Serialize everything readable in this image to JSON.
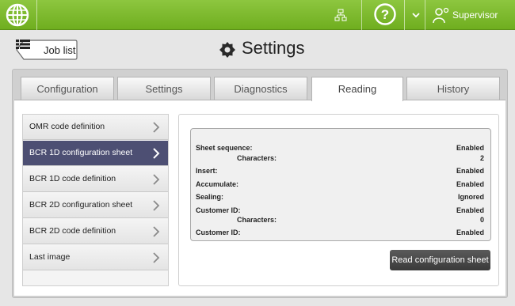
{
  "topbar": {
    "role": "Supervisor",
    "accent": "#8dc63f",
    "icons": [
      "globe-icon",
      "network-icon",
      "help-icon",
      "dropdown-icon",
      "user-icon"
    ]
  },
  "header": {
    "back_label": "Job list",
    "title": "Settings"
  },
  "tabs": [
    {
      "label": "Configuration"
    },
    {
      "label": "Settings"
    },
    {
      "label": "Diagnostics"
    },
    {
      "label": "Reading",
      "active": true
    },
    {
      "label": "History"
    }
  ],
  "menu": [
    {
      "label": "OMR code definition"
    },
    {
      "label": "BCR 1D configuration sheet",
      "selected": true
    },
    {
      "label": "BCR 1D code definition"
    },
    {
      "label": "BCR 2D configuration sheet"
    },
    {
      "label": "BCR 2D code definition"
    },
    {
      "label": "Last image"
    }
  ],
  "config": {
    "rows": [
      {
        "label": "Sheet sequence:",
        "value": "Enabled"
      },
      {
        "label": "Characters:",
        "value": "2"
      },
      {
        "label": "Insert:",
        "value": "Enabled"
      },
      {
        "label": "Accumulate:",
        "value": "Enabled"
      },
      {
        "label": "Sealing:",
        "value": "Ignored"
      },
      {
        "label": "Customer ID:",
        "value": "Enabled"
      },
      {
        "label": "Characters:",
        "value": "0"
      },
      {
        "label": "Customer ID:",
        "value": "Enabled"
      }
    ]
  },
  "actions": {
    "read_label": "Read configuration sheet"
  }
}
